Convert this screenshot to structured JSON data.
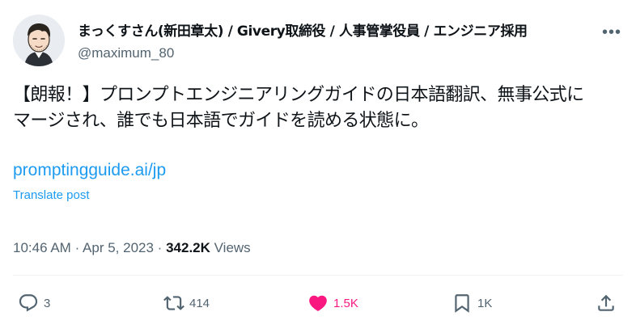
{
  "author": {
    "display_name": "まっくすさん(新田章太) / Givery取締役 / 人事管掌役員 / エンジニア採用",
    "handle": "@maximum_80"
  },
  "more_icon": "more-horizontal-icon",
  "tweet": {
    "text_lines": [
      "【朗報！】プロンプトエンジニアリングガイドの日本語翻訳、無事公式に",
      "マージされ、誰でも日本語でガイドを読める状態に。"
    ],
    "link": "promptingguide.ai/jp",
    "translate_label": "Translate post",
    "time": "10:46 AM",
    "date": "Apr 5, 2023",
    "separator": "·",
    "views_count": "342.2K",
    "views_label": "Views"
  },
  "actions": {
    "reply": {
      "icon": "reply-icon",
      "count": "3"
    },
    "retweet": {
      "icon": "retweet-icon",
      "count": "414"
    },
    "like": {
      "icon": "heart-icon",
      "count": "1.5K",
      "active": true,
      "color": "#f91880"
    },
    "bookmark": {
      "icon": "bookmark-icon",
      "count": "1K"
    },
    "share": {
      "icon": "share-icon"
    }
  },
  "colors": {
    "link": "#1d9bf0",
    "secondary_text": "#536471",
    "primary_text": "#0f1419",
    "divider": "#eff3f4"
  }
}
